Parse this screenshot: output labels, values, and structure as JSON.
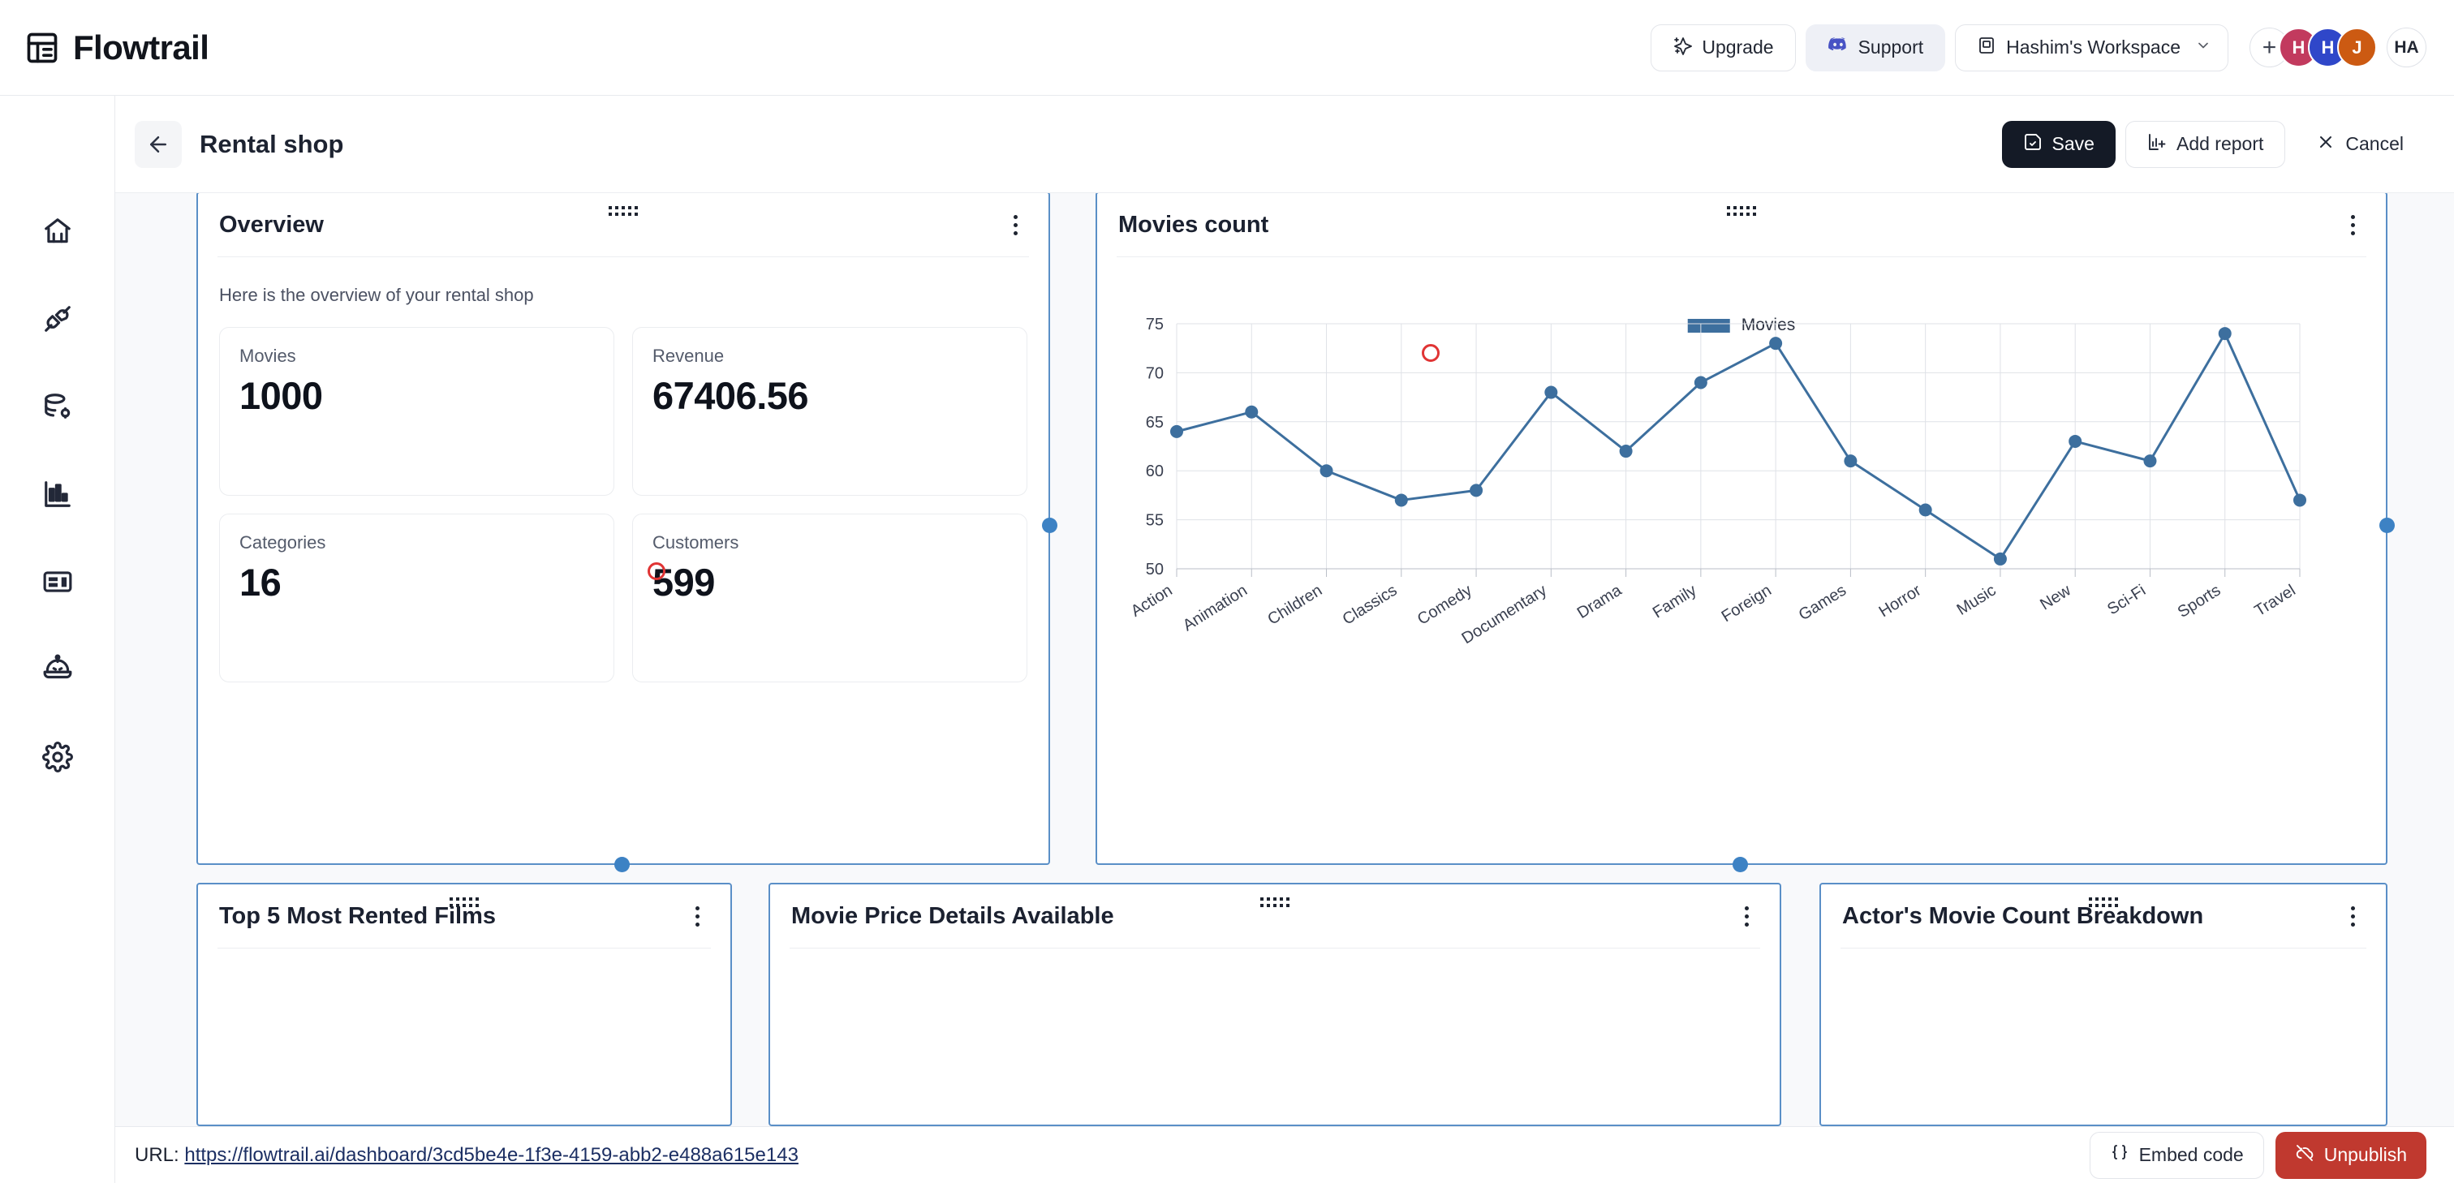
{
  "app": {
    "brand_name": "Flowtrail",
    "logo_icon": "flowtrail-grid-icon"
  },
  "header": {
    "upgrade_label": "Upgrade",
    "upgrade_icon": "sparkles-icon",
    "support_label": "Support",
    "support_icon": "discord-icon",
    "workspace_label": "Hashim's Workspace",
    "workspace_icon": "workspace-icon",
    "workspace_chevron": "chevron-down-icon",
    "avatars": [
      {
        "label": "+",
        "color": "#ffffff",
        "name": "add-member-button"
      },
      {
        "label": "H",
        "color": "#c23a5e",
        "name": "avatar-h-red"
      },
      {
        "label": "H",
        "color": "#2f47c9",
        "name": "avatar-h-blue"
      },
      {
        "label": "J",
        "color": "#cc5a12",
        "name": "avatar-j-orange"
      }
    ],
    "account_initials": "HA"
  },
  "subheader": {
    "back_icon": "arrow-left-icon",
    "title": "Rental shop",
    "save_label": "Save",
    "save_icon": "save-icon",
    "add_report_label": "Add report",
    "add_report_icon": "chart-add-icon",
    "cancel_label": "Cancel",
    "cancel_icon": "close-icon"
  },
  "sidebar": {
    "items": [
      {
        "name": "sidebar-item-home",
        "icon": "home-icon"
      },
      {
        "name": "sidebar-item-connections",
        "icon": "plug-icon"
      },
      {
        "name": "sidebar-item-datasources",
        "icon": "database-settings-icon"
      },
      {
        "name": "sidebar-item-analytics",
        "icon": "bar-chart-icon"
      },
      {
        "name": "sidebar-item-dashboards",
        "icon": "layout-panel-icon"
      },
      {
        "name": "sidebar-item-ai-assistant",
        "icon": "robot-icon"
      },
      {
        "name": "sidebar-item-settings",
        "icon": "gear-icon"
      }
    ]
  },
  "cards": {
    "overview": {
      "title": "Overview",
      "subtitle": "Here is the overview of your rental shop",
      "stats": [
        {
          "label": "Movies",
          "value": "1000"
        },
        {
          "label": "Revenue",
          "value": "67406.56"
        },
        {
          "label": "Categories",
          "value": "16"
        },
        {
          "label": "Customers",
          "value": "599"
        }
      ]
    },
    "movies_count": {
      "title": "Movies count"
    },
    "top_films": {
      "title": "Top 5 Most Rented Films"
    },
    "price_details": {
      "title": "Movie Price Details Available"
    },
    "actor_breakdown": {
      "title": "Actor's Movie Count Breakdown"
    }
  },
  "chart_data": {
    "type": "line",
    "title": "Movies count",
    "xlabel": "",
    "ylabel": "",
    "ylim": [
      50,
      75
    ],
    "yticks": [
      50,
      55,
      60,
      65,
      70,
      75
    ],
    "grid": true,
    "legend_position": "top-center",
    "series": [
      {
        "name": "Movies",
        "color": "#3d6f9e",
        "values": [
          64,
          66,
          60,
          57,
          58,
          68,
          62,
          69,
          73,
          61,
          56,
          51,
          63,
          61,
          74,
          57
        ]
      }
    ],
    "categories": [
      "Action",
      "Animation",
      "Children",
      "Classics",
      "Comedy",
      "Documentary",
      "Drama",
      "Family",
      "Foreign",
      "Games",
      "Horror",
      "Music",
      "New",
      "Sci-Fi",
      "Sports",
      "Travel"
    ]
  },
  "footer": {
    "url_prefix": "URL:",
    "url": "https://flowtrail.ai/dashboard/3cd5be4e-1f3e-4159-abb2-e488a615e143",
    "embed_label": "Embed code",
    "embed_icon": "braces-icon",
    "unpublish_label": "Unpublish",
    "unpublish_icon": "cloud-off-icon"
  },
  "colors": {
    "accent_blue": "#3d82c4",
    "selection_border": "#5a8fc7",
    "series_blue": "#3d6f9e",
    "danger_red": "#c0392f",
    "cursor_red": "#e03434",
    "dark_button": "#141a26"
  }
}
